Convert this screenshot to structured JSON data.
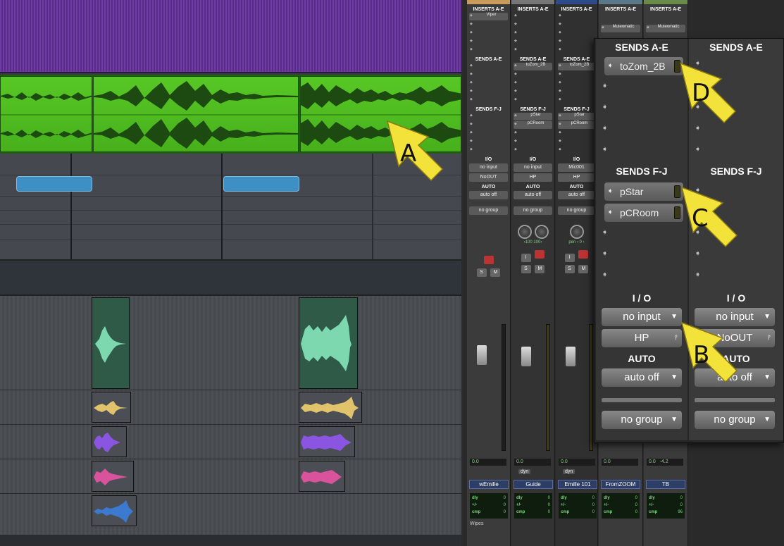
{
  "mixer": {
    "strips": [
      {
        "name": "wEmille",
        "color": "#c99a5a",
        "inserts_label": "INSERTS A-E",
        "insert_1": "Viper",
        "sends_ae_label": "SENDS A-E",
        "send_ae": "",
        "sends_fj_label": "SENDS F-J",
        "send_f": "",
        "send_g": "",
        "io_label": "I/O",
        "input": "no input",
        "output": "NoOUT",
        "auto_label": "AUTO",
        "auto": "auto off",
        "group": "no group",
        "vol": "0.0",
        "bottom_label": "Wipes",
        "dly": "0",
        "pm": "0",
        "cmp": "0"
      },
      {
        "name": "Guide",
        "color": "#777",
        "inserts_label": "INSERTS A-E",
        "insert_1": "",
        "sends_ae_label": "SENDS A-E",
        "send_ae": "toZom_2B",
        "sends_fj_label": "SENDS F-J",
        "send_f": "pStar",
        "send_g": "pCRoom",
        "io_label": "I/O",
        "input": "no input",
        "output": "HP",
        "auto_label": "AUTO",
        "auto": "auto off",
        "group": "no group",
        "vol": "0.0",
        "pan_l": "‹100",
        "pan_r": "100›",
        "dyn": "dyn",
        "dly": "0",
        "pm": "0",
        "cmp": "0"
      },
      {
        "name": "Emille 101",
        "color": "#2d4a8a",
        "inserts_label": "INSERTS A-E",
        "insert_1": "",
        "sends_ae_label": "SENDS A-E",
        "send_ae": "toZom_2B",
        "sends_fj_label": "SENDS F-J",
        "send_f": "pStar",
        "send_g": "pCRoom",
        "io_label": "I/O",
        "input": "Mic001",
        "output": "HP",
        "auto_label": "AUTO",
        "auto": "auto off",
        "group": "no group",
        "vol": "0.0",
        "pan": "pen",
        "pan_val": "0",
        "dyn": "dyn",
        "dly": "0",
        "pm": "0",
        "cmp": "0"
      },
      {
        "name": "FromZOOM",
        "color": "#5a7a8a",
        "inserts_label": "INSERTS A-E",
        "insert_1": "Muteomatic",
        "vol": "0.0",
        "dly": "0",
        "pm": "0",
        "cmp": "0"
      },
      {
        "name": "TB",
        "color": "#6a8a4a",
        "inserts_label": "INSERTS A-E",
        "insert_1": "Muteomatic",
        "vol": "0.0",
        "vol2": "-4.2",
        "dly": "0",
        "pm": "0",
        "cmp": "96"
      }
    ],
    "fader_scale": [
      "12",
      "6",
      "0",
      "5",
      "10",
      "15",
      "20",
      "30",
      "40",
      "60"
    ],
    "meter_scale": [
      "0",
      "3",
      "6",
      "9",
      "12",
      "15",
      "20",
      "30",
      "40",
      "60"
    ],
    "dly_label": "dly",
    "pm_label": "+/-",
    "cmp_label": "cmp",
    "solo": "S",
    "mute": "M",
    "input_btn": "I"
  },
  "zoom": {
    "col1": {
      "sends_ae_label": "SENDS A-E",
      "send_a": "toZom_2B",
      "sends_fj_label": "SENDS F-J",
      "send_f": "pStar",
      "send_g": "pCRoom",
      "io_label": "I / O",
      "input": "no input",
      "output": "HP",
      "auto_label": "AUTO",
      "auto": "auto off",
      "group": "no group"
    },
    "col2": {
      "sends_ae_label": "SENDS A-E",
      "sends_fj_label": "SENDS F-J",
      "io_label": "I / O",
      "input": "no input",
      "output": "NoOUT",
      "auto_label": "AUTO",
      "auto": "auto off",
      "group": "no group"
    }
  },
  "callouts": [
    "A",
    "B",
    "C",
    "D"
  ]
}
